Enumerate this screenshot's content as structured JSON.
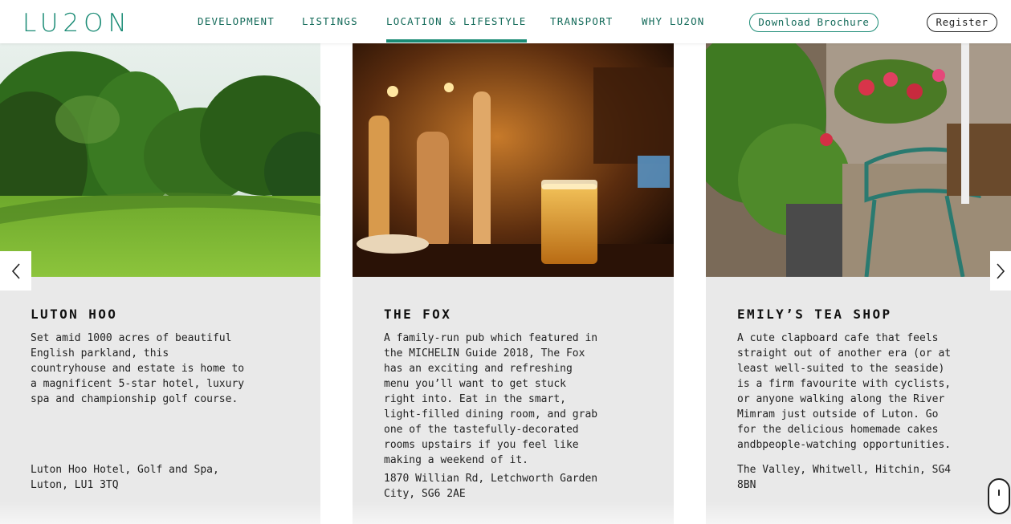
{
  "header": {
    "logo": "LU2ON",
    "nav": [
      "DEVELOPMENT",
      "LISTINGS",
      "LOCATION & LIFESTYLE",
      "TRANSPORT",
      "WHY LU2ON"
    ],
    "active_nav": "LOCATION & LIFESTYLE",
    "brochure_label": "Download Brochure",
    "register_label": "Register"
  },
  "colors": {
    "accent": "#1a8b75",
    "accent_dark": "#146b5a",
    "card_bg": "#e9e9e9"
  },
  "cards": [
    {
      "title": "LUTON HOO",
      "description": "Set amid 1000 acres of beautiful\nEnglish parkland, this\ncountryhouse and estate is home to\na magnificent 5-star hotel, luxury\nspa and championship golf course.",
      "address": "Luton Hoo Hotel, Golf and Spa,\nLuton, LU1 3TQ"
    },
    {
      "title": "THE FOX",
      "description": "A family-run pub which featured in\nthe MICHELIN Guide 2018, The Fox\nhas an exciting and refreshing\nmenu you’ll want to get stuck\nright into. Eat in the smart,\nlight-filled dining room, and grab\none of the tastefully-decorated\nrooms upstairs if you feel like\nmaking a weekend of it.",
      "address": "1870 Willian Rd, Letchworth Garden\nCity, SG6 2AE"
    },
    {
      "title": "EMILY’S TEA SHOP",
      "description": "A cute clapboard cafe that feels\nstraight out of another era (or at\nleast well-suited to the seaside)\nis a firm favourite with cyclists,\nor anyone walking along the River\nMimram just outside of Luton. Go\nfor the delicious homemade cakes\nandbpeople-watching opportunities.",
      "address": "The Valley, Whitwell, Hitchin, SG4\n8BN"
    }
  ],
  "icons": {
    "prev": "chevron-left-icon",
    "next": "chevron-right-icon",
    "scroll": "mouse-scroll-icon"
  }
}
